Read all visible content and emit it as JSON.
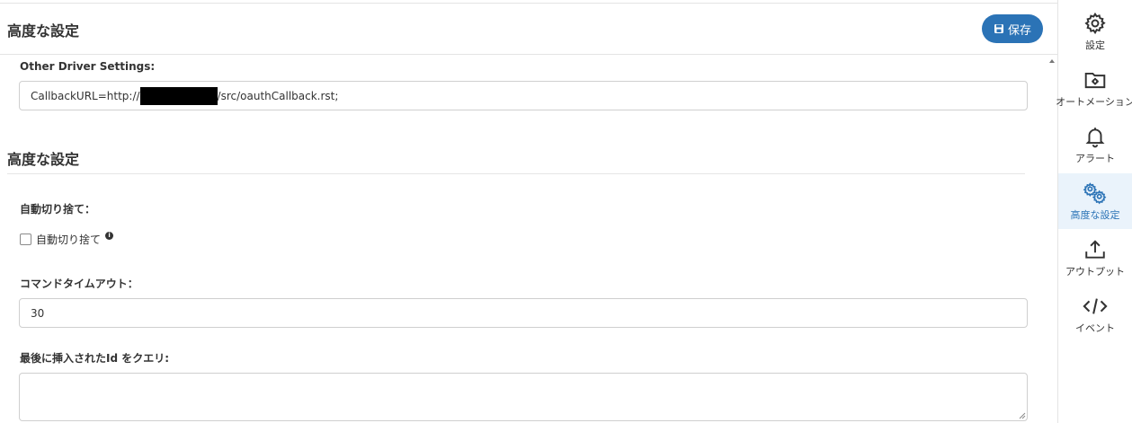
{
  "header": {
    "title": "高度な設定",
    "save_label": "保存"
  },
  "form": {
    "other_driver_label": "Other Driver Settings:",
    "callback_prefix": "CallbackURL=http://",
    "callback_suffix": "/src/oauthCallback.rst;",
    "section_title": "高度な設定",
    "auto_truncate_label": "自動切り捨て：",
    "auto_truncate_checkbox_label": "自動切り捨て",
    "command_timeout_label": "コマンドタイムアウト：",
    "command_timeout_value": "30",
    "last_inserted_id_label": "最後に挿入されたId をクエリ:",
    "last_inserted_id_value": ""
  },
  "sidebar": {
    "items": [
      {
        "label": "設定",
        "icon": "gear-icon"
      },
      {
        "label": "オートメーション",
        "icon": "folder-gear-icon"
      },
      {
        "label": "アラート",
        "icon": "bell-icon"
      },
      {
        "label": "高度な設定",
        "icon": "gears-icon",
        "active": true
      },
      {
        "label": "アウトプット",
        "icon": "upload-icon"
      },
      {
        "label": "イベント",
        "icon": "code-icon"
      }
    ]
  },
  "colors": {
    "accent": "#2b73b6",
    "active_bg": "#eaf3fb"
  }
}
